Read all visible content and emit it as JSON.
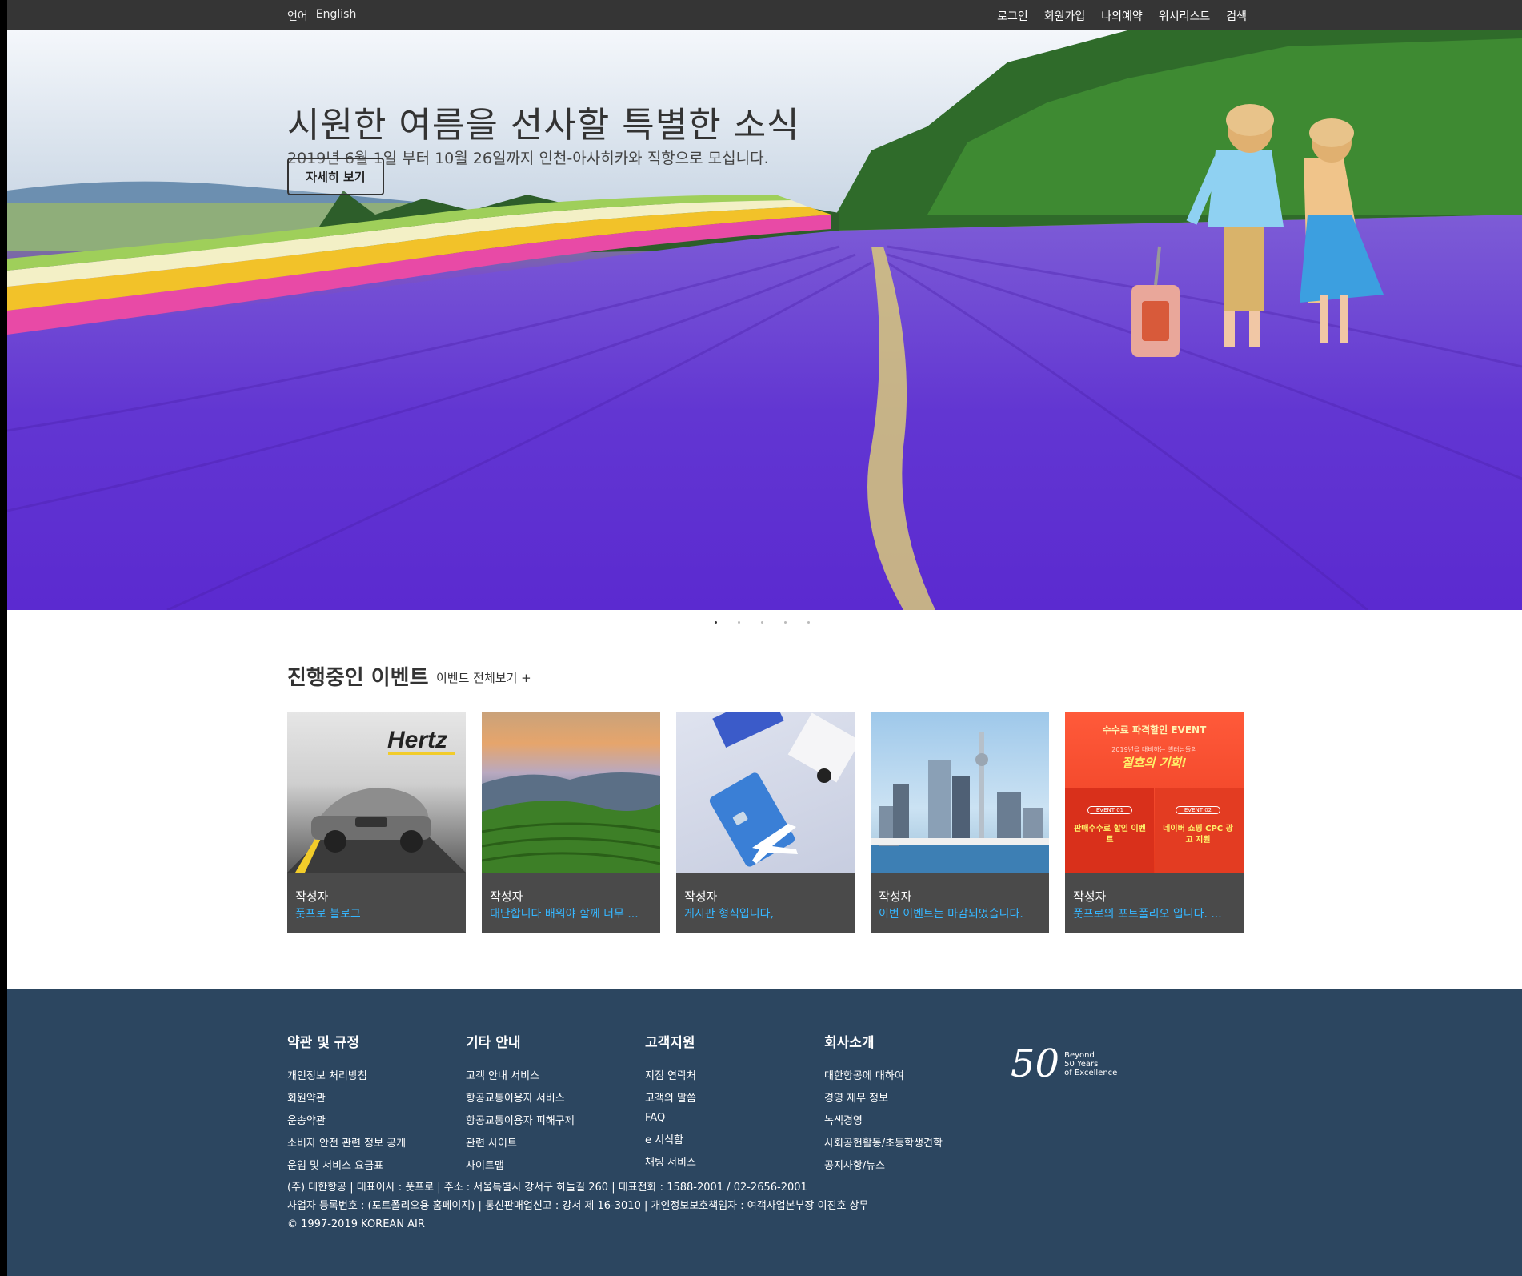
{
  "topbar": {
    "lang_label": "언어",
    "lang_value": "English",
    "menu": [
      "로그인",
      "회원가입",
      "나의예약",
      "위시리스트",
      "검색"
    ]
  },
  "hero": {
    "title": "시원한 여름을 선사할 특별한 소식",
    "subtitle": "2019년 6월 1일 부터 10월 26일까지 인천-아사히카와 직항으로 모십니다.",
    "button": "자세히 보기"
  },
  "events": {
    "title": "진행중인 이벤트",
    "view_all": "이벤트 전체보기 +",
    "cards": [
      {
        "author": "작성자",
        "desc": "풋프로 블로그",
        "brand": "Hertz"
      },
      {
        "author": "작성자",
        "desc": "대단합니다 배워야 할께 너무 ..."
      },
      {
        "author": "작성자",
        "desc": "게시판 형식입니다,"
      },
      {
        "author": "작성자",
        "desc": "이번 이벤트는 마감되었습니다."
      },
      {
        "author": "작성자",
        "desc": "풋프로의 포트폴리오 입니다. ...",
        "event_title": "수수료 파격할인 EVENT",
        "event_sub": "2019년을 대비하는 셀러님들의",
        "event_head": "절호의 기회!",
        "event1_tag": "EVENT 01",
        "event1": "판매수수료 할인 이벤트",
        "event2_tag": "EVENT 02",
        "event2": "네이버 쇼핑 CPC 광고 지원"
      }
    ]
  },
  "footer": {
    "columns": [
      {
        "title": "약관 및 규정",
        "items": [
          "개인정보 처리방침",
          "회원약관",
          "운송약관",
          "소비자 안전 관련 정보 공개",
          "운임 및 서비스 요금표"
        ]
      },
      {
        "title": "기타 안내",
        "items": [
          "고객 안내 서비스",
          "항공교통이용자 서비스",
          "항공교통이용자 피해구제",
          "관련 사이트",
          "사이트맵"
        ]
      },
      {
        "title": "고객지원",
        "items": [
          "지점 연락처",
          "고객의 말씀",
          "FAQ",
          "e 서식함",
          "채팅 서비스"
        ]
      },
      {
        "title": "회사소개",
        "items": [
          "대한항공에 대하여",
          "경영 재무 정보",
          "녹색경영",
          "사회공헌활동/초등학생견학",
          "공지사항/뉴스"
        ]
      }
    ],
    "info_line1": "(주) 대한항공  |  대표이사 : 풋프로  |  주소 : 서울특별시 강서구 하늘길 260  |  대표전화 : 1588-2001 / 02-2656-2001",
    "info_line2": "사업자 등록번호 : (포트폴리오용 홈페이지)  |  통신판매업신고 : 강서 제 16-3010  |  개인정보보호책임자 : 여객사업본부장 이진호 상무",
    "copyright": "© 1997-2019 KOREAN AIR",
    "logo_num": "50",
    "logo_tag": [
      "Beyond",
      "50 Years",
      "of Excellence"
    ]
  }
}
